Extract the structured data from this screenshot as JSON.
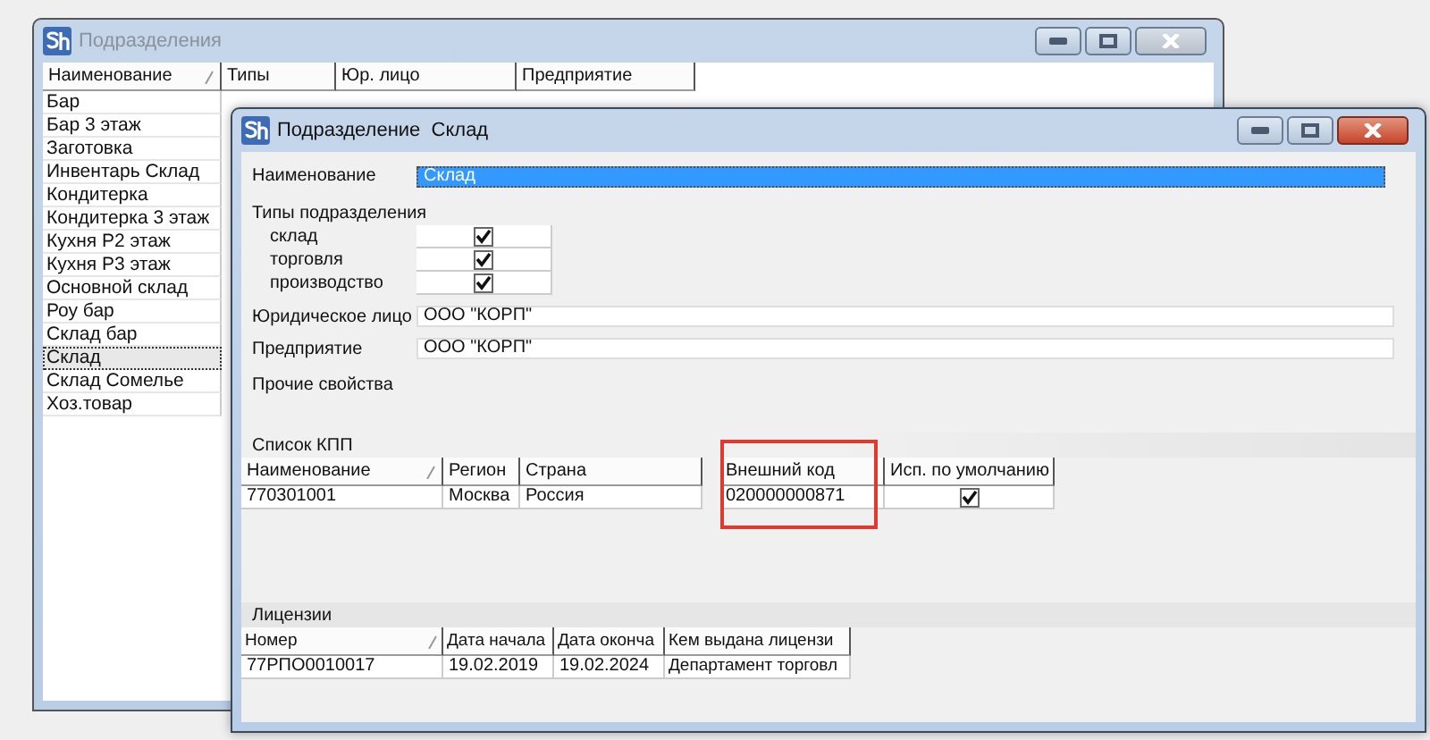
{
  "back_window": {
    "title": "Подразделения",
    "active": false,
    "table": {
      "columns": [
        {
          "label": "Наименование",
          "sorted": true
        },
        {
          "label": "Типы",
          "sorted": false
        },
        {
          "label": "Юр. лицо",
          "sorted": false
        },
        {
          "label": "Предприятие",
          "sorted": false
        }
      ],
      "rows": [
        {
          "name": "Бар",
          "selected": false
        },
        {
          "name": "Бар 3 этаж",
          "selected": false
        },
        {
          "name": "Заготовка",
          "selected": false
        },
        {
          "name": "Инвентарь Склад",
          "selected": false
        },
        {
          "name": "Кондитерка",
          "selected": false
        },
        {
          "name": "Кондитерка 3 этаж",
          "selected": false
        },
        {
          "name": "Кухня Р2 этаж",
          "selected": false
        },
        {
          "name": "Кухня Р3 этаж",
          "selected": false
        },
        {
          "name": "Основной склад",
          "selected": false
        },
        {
          "name": "Роу бар",
          "selected": false
        },
        {
          "name": "Склад бар",
          "selected": false
        },
        {
          "name": "Склад",
          "selected": true
        },
        {
          "name": "Склад Сомелье",
          "selected": false
        },
        {
          "name": "Хоз.товар",
          "selected": false
        }
      ]
    }
  },
  "front_window": {
    "title": "Подразделение  Склад",
    "active": true,
    "name_field": {
      "label": "Наименование",
      "value": "Склад"
    },
    "types": {
      "label": "Типы подразделения",
      "items": [
        {
          "label": "склад",
          "checked": true
        },
        {
          "label": "торговля",
          "checked": true
        },
        {
          "label": "производство",
          "checked": true
        }
      ]
    },
    "legal_entity": {
      "label": "Юридическое лицо",
      "value": "ООО \"КОРП\""
    },
    "enterprise": {
      "label": "Предприятие",
      "value": "ООО \"КОРП\""
    },
    "other_properties": "Прочие свойства",
    "kpp": {
      "title": "Список КПП",
      "columns": [
        {
          "label": "Наименование",
          "sorted": true,
          "highlighted": false
        },
        {
          "label": "Регион",
          "sorted": false,
          "highlighted": false
        },
        {
          "label": "Страна",
          "sorted": false,
          "highlighted": false
        },
        {
          "label": "Внешний код",
          "sorted": false,
          "highlighted": true
        },
        {
          "label": "Исп. по умолчанию",
          "sorted": false,
          "highlighted": false
        }
      ],
      "rows": [
        {
          "name": "770301001",
          "region": "Москва",
          "country": "Россия",
          "external_code": "020000000871",
          "default": true
        }
      ]
    },
    "licenses": {
      "title": "Лицензии",
      "columns": [
        {
          "label": "Номер",
          "sorted": true
        },
        {
          "label": "Дата начала",
          "sorted": false
        },
        {
          "label": "Дата оконча",
          "sorted": false
        },
        {
          "label": "Кем выдана лицензи",
          "sorted": false
        }
      ],
      "rows": [
        {
          "number": "77РПО0010017",
          "start": "19.02.2019",
          "end": "19.02.2024",
          "issuer": "Департамент торговл"
        }
      ]
    }
  }
}
